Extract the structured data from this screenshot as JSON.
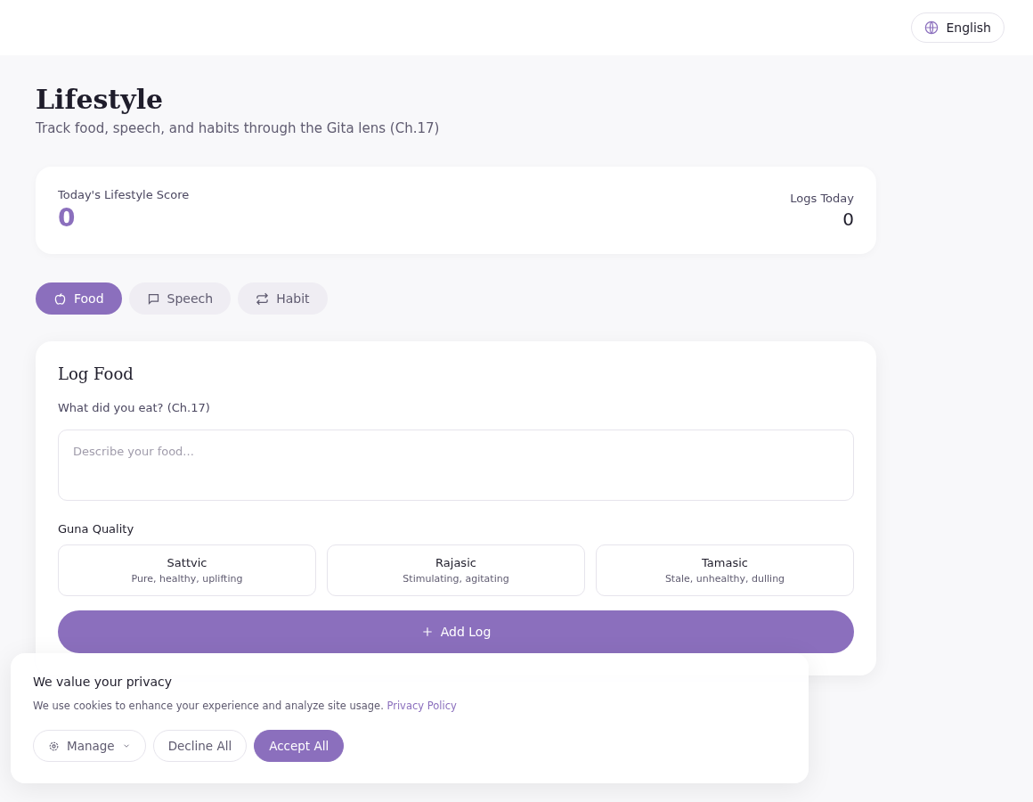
{
  "header": {
    "language": "English"
  },
  "page": {
    "title": "Lifestyle",
    "subtitle": "Track food, speech, and habits through the Gita lens (Ch.17)"
  },
  "score_card": {
    "score_label": "Today's Lifestyle Score",
    "score": "0",
    "logs_label": "Logs Today",
    "logs": "0"
  },
  "tabs": [
    {
      "label": "Food",
      "kind": "food",
      "selected": true
    },
    {
      "label": "Speech",
      "kind": "speech",
      "selected": false
    },
    {
      "label": "Habit",
      "kind": "habit",
      "selected": false
    }
  ],
  "form": {
    "title": "Log Food",
    "question": "What did you eat? (Ch.17)",
    "placeholder": "Describe your food...",
    "guna_label": "Guna Quality",
    "options": [
      {
        "name": "Sattvic",
        "description": "Pure, healthy, uplifting",
        "selected": false
      },
      {
        "name": "Rajasic",
        "description": "Stimulating, agitating",
        "selected": false
      },
      {
        "name": "Tamasic",
        "description": "Stale, unhealthy, dulling",
        "selected": false
      }
    ],
    "submit": "Add Log"
  },
  "cookie_banner": {
    "title": "We value your privacy",
    "text": "We use cookies to enhance your experience and analyze site usage.",
    "link": "Privacy Policy",
    "buttons": [
      {
        "label": "Manage",
        "kind": "manage"
      },
      {
        "label": "Decline All",
        "kind": "decline"
      },
      {
        "label": "Accept All",
        "kind": "accept"
      }
    ]
  }
}
